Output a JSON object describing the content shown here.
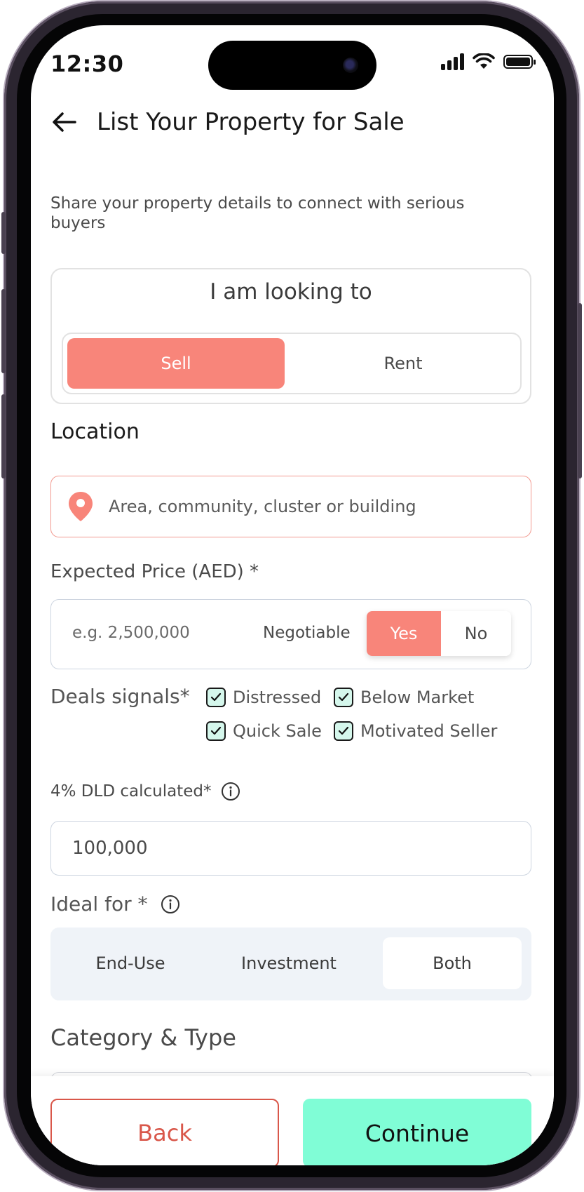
{
  "status_bar": {
    "time": "12:30"
  },
  "header": {
    "title": "List Your Property for Sale"
  },
  "subtitle": "Share your property details to connect with serious buyers",
  "looking_to": {
    "title": "I am looking to",
    "options": [
      "Sell",
      "Rent"
    ],
    "selected": "Sell"
  },
  "location": {
    "label": "Location",
    "placeholder": "Area, community, cluster or building"
  },
  "expected_price": {
    "label": "Expected Price (AED) *",
    "placeholder": "e.g. 2,500,000",
    "negotiable_label": "Negotiable",
    "yes_label": "Yes",
    "no_label": "No",
    "negotiable_selected": "Yes"
  },
  "deals_signals": {
    "label": "Deals signals*",
    "options": [
      {
        "label": "Distressed",
        "checked": true
      },
      {
        "label": "Below Market",
        "checked": true
      },
      {
        "label": "Quick Sale",
        "checked": true
      },
      {
        "label": "Motivated Seller",
        "checked": true
      }
    ]
  },
  "dld": {
    "label": "4% DLD calculated*",
    "value": "100,000"
  },
  "ideal_for": {
    "label": "Ideal for *",
    "options": [
      "End-Use",
      "Investment",
      "Both"
    ],
    "selected": "Both"
  },
  "category": {
    "label": "Category & Type"
  },
  "footer": {
    "back_label": "Back",
    "continue_label": "Continue"
  },
  "colors": {
    "accent": "#f8857a",
    "continue": "#80fdd6",
    "back_border": "#d9574a"
  },
  "icons": [
    "back-arrow-icon",
    "location-pin-icon",
    "check-icon",
    "info-icon",
    "signal-icon",
    "wifi-icon",
    "battery-icon"
  ]
}
